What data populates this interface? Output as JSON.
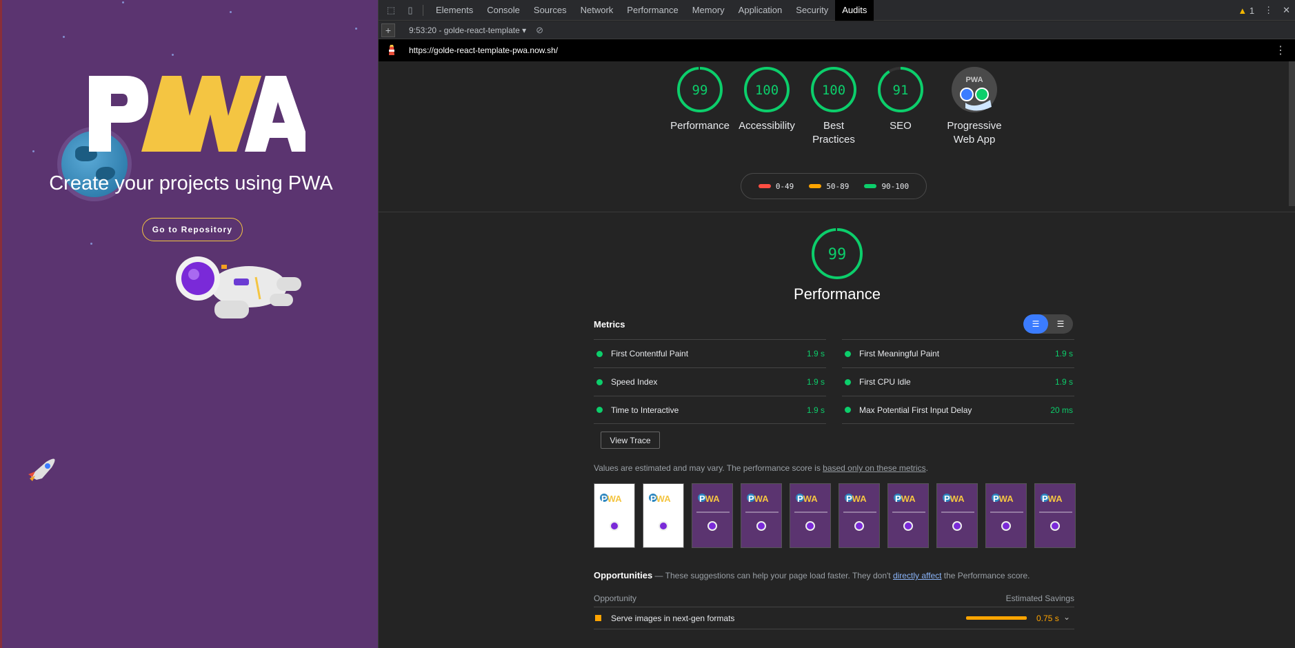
{
  "site": {
    "logo_text": "PWA",
    "tagline": "Create your projects using PWA",
    "repo_button": "Go to Repository"
  },
  "devtools": {
    "tabs": [
      "Elements",
      "Console",
      "Sources",
      "Network",
      "Performance",
      "Memory",
      "Application",
      "Security",
      "Audits"
    ],
    "active_tab": "Audits",
    "warning_count": "1",
    "report_select": "9:53:20 - golde-react-template",
    "url": "https://golde-react-template-pwa.now.sh/"
  },
  "scores": [
    {
      "value": "99",
      "label": "Performance",
      "fraction": 0.99
    },
    {
      "value": "100",
      "label": "Accessibility",
      "fraction": 1.0
    },
    {
      "value": "100",
      "label": "Best Practices",
      "fraction": 1.0
    },
    {
      "value": "91",
      "label": "SEO",
      "fraction": 0.91
    },
    {
      "value": "",
      "label": "Progressive Web App",
      "badge_text": "PWA"
    }
  ],
  "legend": [
    "0-49",
    "50-89",
    "90-100"
  ],
  "colors": {
    "pass": "#0cce6b",
    "average": "#ffa400",
    "fail": "#ff4e42",
    "accent": "#3b7cff"
  },
  "performance": {
    "score": "99",
    "fraction": 0.99,
    "title": "Performance",
    "metrics_title": "Metrics",
    "metrics_left": [
      {
        "name": "First Contentful Paint",
        "value": "1.9 s"
      },
      {
        "name": "Speed Index",
        "value": "1.9 s"
      },
      {
        "name": "Time to Interactive",
        "value": "1.9 s"
      }
    ],
    "metrics_right": [
      {
        "name": "First Meaningful Paint",
        "value": "1.9 s"
      },
      {
        "name": "First CPU Idle",
        "value": "1.9 s"
      },
      {
        "name": "Max Potential First Input Delay",
        "value": "20 ms"
      }
    ],
    "view_trace": "View Trace",
    "note_prefix": "Values are estimated and may vary. The performance score is ",
    "note_link": "based only on these metrics",
    "note_suffix": "."
  },
  "opportunities": {
    "title": "Opportunities",
    "text_prefix": " — These suggestions can help your page load faster. They don't ",
    "link": "directly affect",
    "text_suffix": " the Performance score.",
    "col_left": "Opportunity",
    "col_right": "Estimated Savings",
    "rows": [
      {
        "name": "Serve images in next-gen formats",
        "value": "0.75 s"
      }
    ]
  }
}
